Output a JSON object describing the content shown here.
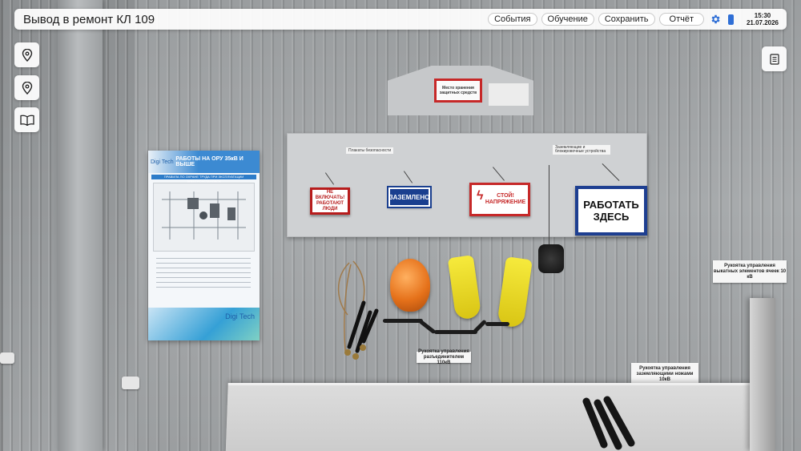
{
  "header": {
    "title": "Вывод в ремонт КЛ 109",
    "buttons": {
      "events": "События",
      "training": "Обучение",
      "save": "Сохранить",
      "report": "Отчёт"
    },
    "time": "15:30",
    "date": "21.07.2026",
    "accent_color": "#2f6fd6"
  },
  "left_toolbar": {
    "icons": [
      "location-pin-icon",
      "location-pin-icon",
      "open-book-icon"
    ]
  },
  "right_toolbar": {
    "icons": [
      "document-list-icon"
    ]
  },
  "scene": {
    "storage_sign": "Место хранения защитных средств",
    "board_label_left": "Плакаты безопасности",
    "board_label_right": "Заземляющие и блокировочные устройства",
    "signs": {
      "no_switch": "НЕ ВКЛЮЧАТЬ! РАБОТАЮТ ЛЮДИ",
      "grounded": "ЗАЗЕМЛЕНО",
      "danger": "СТОЙ! НАПРЯЖЕНИЕ",
      "work_here": "РАБОТАТЬ ЗДЕСЬ"
    },
    "poster": {
      "brand": "Digi Tech",
      "title": "РАБОТЫ НА ОРУ 35кВ И ВЫШЕ",
      "subtitle": "ПРАВИЛА ПО ОХРАНЕ ТРУДА ПРИ ЭКСПЛУАТАЦИИ ЭЛЕКТРОУСТАНОВОК",
      "footer_brand": "Digi Tech"
    },
    "labels": {
      "grounding_handle": "Рукоятка управления разъединителем 110кВ",
      "cart_handle": "Рукоятка управления выкатных элементов ячеек 10 кВ",
      "earthing_knife_handle": "Рукоятка управления заземляющими ножами 10кВ"
    }
  }
}
